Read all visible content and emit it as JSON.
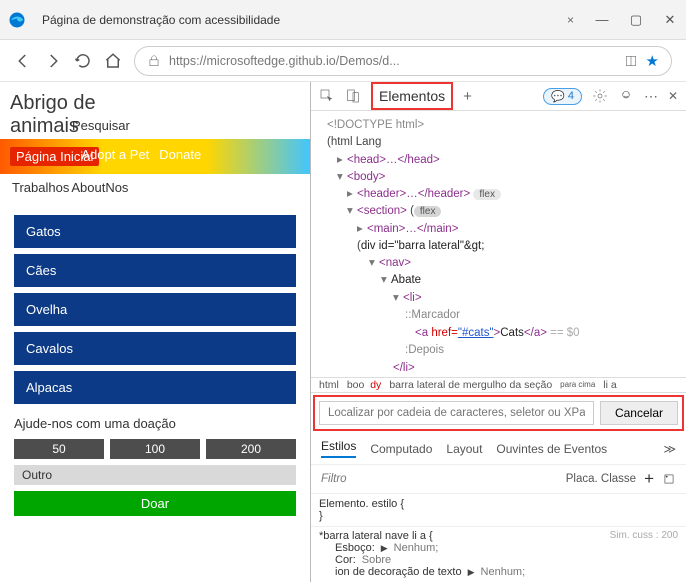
{
  "window": {
    "tab_title": "Página de demonstração com acessibilidade"
  },
  "address": {
    "url": "https://microsoftedge.github.io/Demos/d..."
  },
  "page": {
    "heading_l1": "Abrigo de",
    "heading_l2": "animais",
    "search_label": "Pesquisar",
    "nav": {
      "home": "Página Inicial",
      "adopt": "Adopt a Pet",
      "donate": "Donate"
    },
    "sub": {
      "jobs": "Trabalhos",
      "about": "About",
      "nos": "Nos"
    },
    "animals": [
      "Gatos",
      "Cães",
      "Ovelha",
      "Cavalos",
      "Alpacas"
    ],
    "donate_heading": "Ajude-nos com uma doação",
    "amounts": [
      "50",
      "100",
      "200"
    ],
    "other": "Outro",
    "doar": "Doar"
  },
  "devtools": {
    "tab": "Elementos",
    "plus": "+",
    "issue_count": "4",
    "dom": {
      "doctype": "<!DOCTYPE html>",
      "html_open": "html Lang",
      "head": "<head>…</head>",
      "body": "<body>",
      "header": "<header>…</header>",
      "section": "<section>",
      "flex": "flex",
      "main": "<main>…</main>",
      "div": "div id=\"barra lateral\"&gt;",
      "nav": "<nav>",
      "abate": "Abate",
      "li": "<li>",
      "marker": "::Marcador",
      "a_line_pre": "<a",
      "a_line_href": "href=",
      "a_line_val": "\"#cats\"",
      "a_line_txt": "Cats",
      "a_line_end": "</a>",
      "a_eq": " == $0",
      "depois": ":Depois",
      "li_close": "</li>"
    },
    "crumb": {
      "c1": "html",
      "c2": "boo",
      "dy": "dy",
      "c3": "barra lateral de mergulho da seção",
      "sup": "para cima",
      "c4": "li a"
    },
    "search_placeholder": "Localizar por cadeia de caracteres, seletor ou XPath",
    "cancel": "Cancelar",
    "tabs2": [
      "Estilos",
      "Computado",
      "Layout",
      "Ouvintes de Eventos"
    ],
    "filter": "Filtro",
    "cls": "Placa. Classe",
    "styles": {
      "r1": "Elemento. estilo {",
      "r1b": "}",
      "r2": "*barra lateral nave li a {",
      "r2_sim": "Sim. cuss : 200",
      "p1": "Esboço:",
      "p1v": "Nenhum;",
      "p2": "Cor:",
      "p2v": "Sobre",
      "p3": "ion de decoração de texto",
      "p3v": "Nenhum;"
    }
  }
}
